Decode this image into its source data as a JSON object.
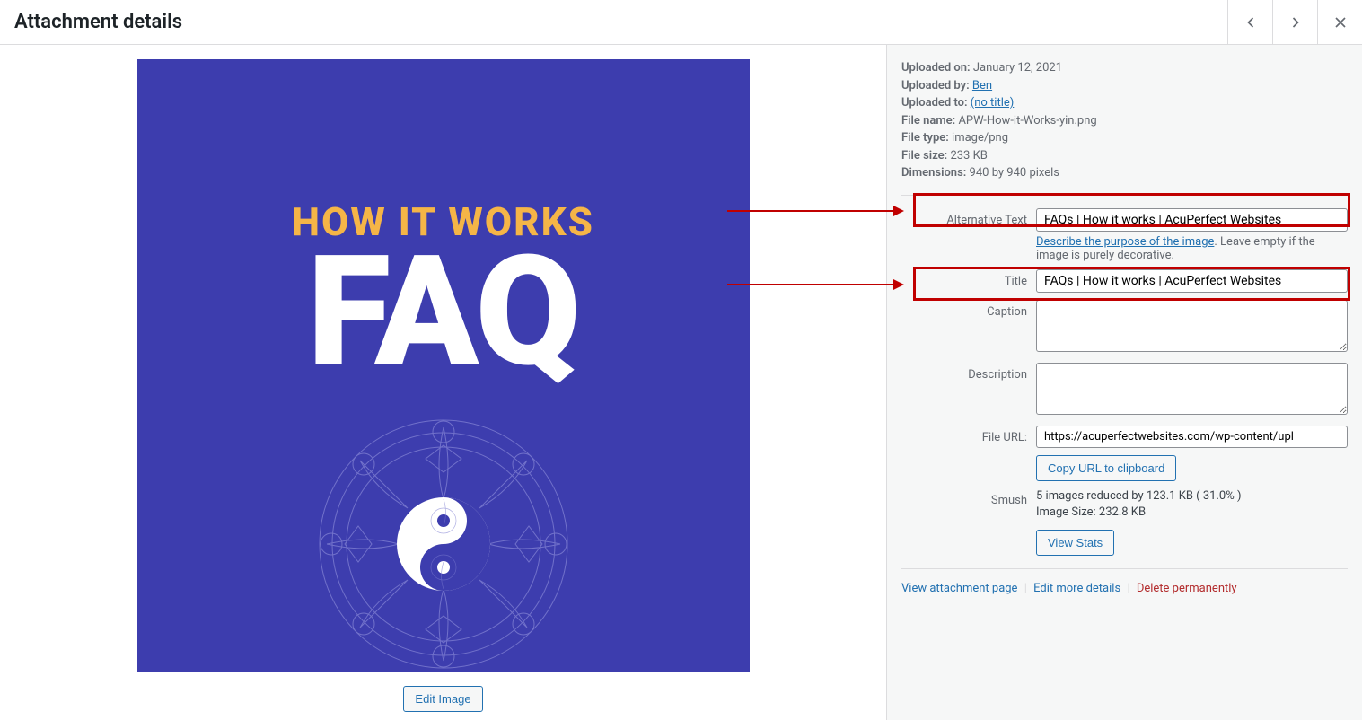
{
  "header": {
    "title": "Attachment details"
  },
  "meta": {
    "uploaded_on_label": "Uploaded on:",
    "uploaded_on": "January 12, 2021",
    "uploaded_by_label": "Uploaded by:",
    "uploaded_by": "Ben",
    "uploaded_to_label": "Uploaded to:",
    "uploaded_to": "(no title)",
    "file_name_label": "File name:",
    "file_name": "APW-How-it-Works-yin.png",
    "file_type_label": "File type:",
    "file_type": "image/png",
    "file_size_label": "File size:",
    "file_size": "233 KB",
    "dimensions_label": "Dimensions:",
    "dimensions": "940 by 940 pixels"
  },
  "fields": {
    "alt_label": "Alternative Text",
    "alt_value": "FAQs | How it works | AcuPerfect Websites",
    "alt_desc_link": "Describe the purpose of the image",
    "alt_desc_rest": ". Leave empty if the image is purely decorative.",
    "title_label": "Title",
    "title_value": "FAQs | How it works | AcuPerfect Websites",
    "caption_label": "Caption",
    "caption_value": "",
    "description_label": "Description",
    "description_value": "",
    "file_url_label": "File URL:",
    "file_url_value": "https://acuperfectwebsites.com/wp-content/upl",
    "copy_url_button": "Copy URL to clipboard",
    "smush_label": "Smush",
    "smush_text_1": "5 images reduced by 123.1 KB ( 31.0% )",
    "smush_text_2": "Image Size: 232.8 KB",
    "view_stats_button": "View Stats"
  },
  "preview": {
    "img_title": "HOW IT WORKS",
    "img_faq": "FAQ",
    "edit_button": "Edit Image"
  },
  "actions": {
    "view": "View attachment page",
    "edit": "Edit more details",
    "delete": "Delete permanently"
  }
}
